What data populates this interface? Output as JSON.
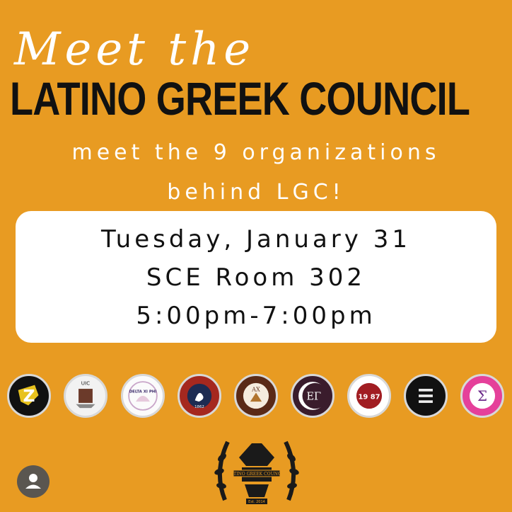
{
  "poster": {
    "script_heading": "Meet the",
    "title": "LATINO GREEK COUNCIL",
    "subtitle_line1": "meet the 9 organizations",
    "subtitle_line2": "behind LGC!"
  },
  "event": {
    "date": "Tuesday, January 31",
    "location": "SCE Room 302",
    "time": "5:00pm-7:00pm"
  },
  "organizations": [
    {
      "icon": "organization-logo-z",
      "text": "Z"
    },
    {
      "icon": "organization-logo-uic-zeta",
      "text": "UIC"
    },
    {
      "icon": "organization-logo-delta-xi-phi",
      "text": "DELTA XI PHI"
    },
    {
      "icon": "organization-logo-swan",
      "text": "1862"
    },
    {
      "icon": "organization-logo-ax",
      "text": "AX"
    },
    {
      "icon": "organization-logo-eg",
      "text": "ΕΓ"
    },
    {
      "icon": "organization-logo-1987",
      "text": "19 87"
    },
    {
      "icon": "organization-logo-stripes",
      "text": ""
    },
    {
      "icon": "organization-logo-sigma",
      "text": "Σ"
    }
  ],
  "crest": {
    "icon": "latino-greek-council-crest-icon",
    "banner_text": "LATINO GREEK COUNCIL",
    "established": "Est. 2014"
  },
  "colors": {
    "background": "#e89b22",
    "card": "#ffffff",
    "title": "#111111"
  },
  "profile": {
    "icon": "user-avatar-icon"
  }
}
